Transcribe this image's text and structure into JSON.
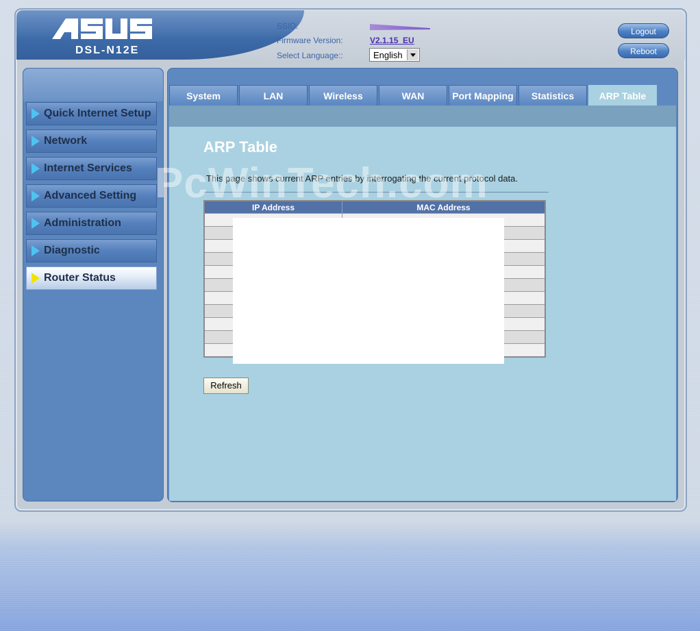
{
  "header": {
    "model": "DSL-N12E",
    "ssid_label": "SSID:",
    "firmware_label": "Firmware Version:",
    "firmware_value": "V2.1.15_EU",
    "language_label": "Select Language::",
    "language_value": "English",
    "logout_label": "Logout",
    "reboot_label": "Reboot"
  },
  "sidebar": {
    "items": [
      {
        "label": "Quick Internet Setup"
      },
      {
        "label": "Network"
      },
      {
        "label": "Internet Services"
      },
      {
        "label": "Advanced Setting"
      },
      {
        "label": "Administration"
      },
      {
        "label": "Diagnostic"
      },
      {
        "label": "Router Status",
        "active": true
      }
    ]
  },
  "tabs": [
    {
      "label": "System"
    },
    {
      "label": "LAN"
    },
    {
      "label": "Wireless"
    },
    {
      "label": "WAN"
    },
    {
      "label": "Port Mapping"
    },
    {
      "label": "Statistics"
    },
    {
      "label": "ARP Table",
      "active": true
    }
  ],
  "main": {
    "title": "ARP Table",
    "description": "This page shows current ARP entries by interrogating the current protocol data.",
    "watermark": "PcWinTech.com",
    "table": {
      "columns": [
        "IP Address",
        "MAC Address"
      ]
    },
    "refresh_label": "Refresh"
  },
  "colors": {
    "accent": "#5b86be",
    "content_bg": "#a9d1e1",
    "table_header": "#5271a6"
  }
}
